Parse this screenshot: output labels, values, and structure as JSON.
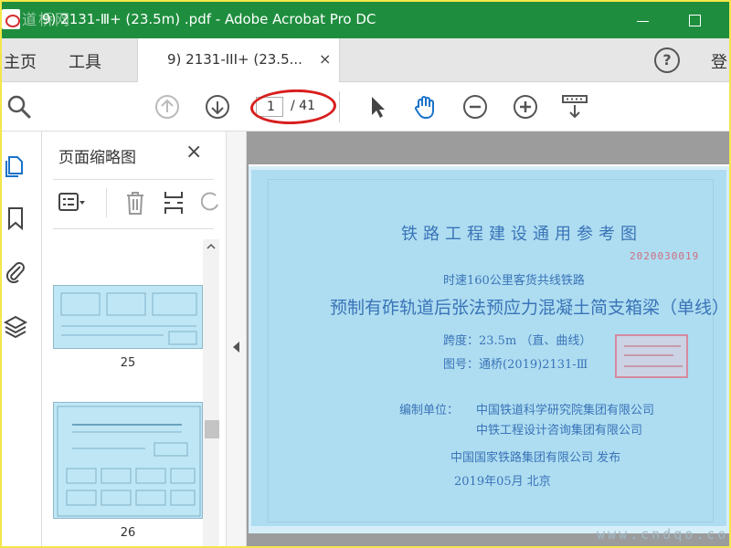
{
  "window": {
    "title": "9) 2131-Ⅲ+  (23.5m)  .pdf - Adobe Acrobat Pro DC",
    "watermark_text": "道桥网"
  },
  "tabs": {
    "home": "主页",
    "tools": "工具",
    "doc_tab": "9)  2131-III+   (23.5...",
    "close_glyph": "×",
    "help_glyph": "?",
    "signin": "登"
  },
  "toolbar": {
    "page_current": "1",
    "page_total": "/ 41",
    "highlight_color": "#d81e1e",
    "icons": [
      "search-icon",
      "prev-page-icon",
      "next-page-icon",
      "select-arrow-icon",
      "hand-tool-icon",
      "zoom-out-icon",
      "zoom-in-icon",
      "scroll-mode-icon"
    ]
  },
  "sidebar": {
    "title": "页面缩略图",
    "close_glyph": "×",
    "rail_icons": [
      "page-thumbnails-icon",
      "bookmark-icon",
      "attachment-icon",
      "layers-icon"
    ],
    "thumbnails": [
      {
        "label": "25"
      },
      {
        "label": "26"
      }
    ]
  },
  "document": {
    "heading": "铁路工程建设通用参考图",
    "code": "2020030019",
    "subtitle": "时速160公里客货共线铁路",
    "main_title": "预制有砟轨道后张法预应力混凝土简支箱梁（单线）",
    "span": "跨度：23.5m   （直、曲线）",
    "drawing_no": "图号：通桥(2019)2131-Ⅲ",
    "org_label": "编制单位：",
    "org1": "中国铁道科学研究院集团有限公司",
    "org2": "中铁工程设计咨询集团有限公司",
    "publisher": "中国国家铁路集团有限公司   发布",
    "date": "2019年05月        北京",
    "watermark": "www.cndqo.com",
    "page_color": "#aeddf1",
    "text_color": "#3a74b8"
  },
  "colors": {
    "titlebar": "#1e8e3e",
    "screenshot_border": "#f4e64a",
    "accent_blue": "#1a73c9"
  }
}
